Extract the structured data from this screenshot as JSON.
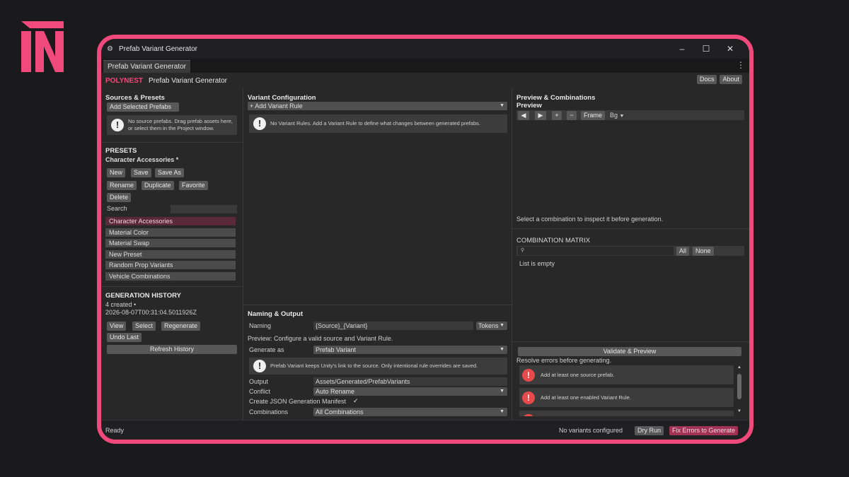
{
  "colors": {
    "accent": "#ef4a7b",
    "error": "#e64a4a",
    "panel": "#282828"
  },
  "logo": {
    "text": "TN"
  },
  "window": {
    "title": "Prefab Variant Generator",
    "controls": [
      "–",
      "☐",
      "✕"
    ]
  },
  "tab": {
    "label": "Prefab Variant Generator",
    "menu_icon": "⋮"
  },
  "header": {
    "brand": "POLYNEST",
    "title": "Prefab Variant Generator",
    "docs": "Docs",
    "about": "About"
  },
  "sources": {
    "title": "Sources & Presets",
    "add_button": "Add Selected Prefabs",
    "help": "No source prefabs. Drag prefab assets here, or select them in the Project window."
  },
  "presets": {
    "title": "PRESETS",
    "current": "Character Accessories *",
    "buttons": {
      "new": "New",
      "save": "Save",
      "save_as": "Save As",
      "rename": "Rename",
      "duplicate": "Duplicate",
      "favorite": "Favorite",
      "delete": "Delete"
    },
    "search_label": "Search",
    "items": [
      "Character Accessories",
      "Material Color",
      "Material Swap",
      "New Preset",
      "Random Prop Variants",
      "Vehicle Combinations"
    ]
  },
  "history": {
    "title": "GENERATION HISTORY",
    "line1": "4 created •",
    "line2": "2026-08-07T00:31:04.5011926Z",
    "buttons": {
      "view": "View",
      "select": "Select",
      "regenerate": "Regenerate",
      "undo": "Undo Last",
      "refresh": "Refresh History"
    }
  },
  "variant": {
    "title": "Variant Configuration",
    "add_rule": "+ Add Variant Rule",
    "help": "No Variant Rules. Add a Variant Rule to define what changes between generated prefabs."
  },
  "naming": {
    "title": "Naming & Output",
    "naming_label": "Naming",
    "naming_value": "{Source}_{Variant}",
    "tokens": "Tokens",
    "preview": "Preview: Configure a valid source and Variant Rule.",
    "generate_as_label": "Generate as",
    "generate_as_value": "Prefab Variant",
    "generate_help": "Prefab Variant keeps Unity's link to the source. Only intentional rule overrides are saved.",
    "output_label": "Output",
    "output_value": "Assets/Generated/PrefabVariants",
    "conflict_label": "Conflict",
    "conflict_value": "Auto Rename",
    "manifest_label": "Create JSON Generation Manifest",
    "manifest_check": "✓",
    "combinations_label": "Combinations",
    "combinations_value": "All Combinations"
  },
  "preview": {
    "title": "Preview & Combinations",
    "subtitle": "Preview",
    "toolbar": {
      "prev": "◀",
      "next": "▶",
      "plus": "+",
      "minus": "−",
      "frame": "Frame",
      "bg": "Bg"
    },
    "empty": "Select a combination to inspect it before generation."
  },
  "matrix": {
    "title": "COMBINATION MATRIX",
    "all": "All",
    "none": "None",
    "empty": "List is empty"
  },
  "validate": {
    "button": "Validate & Preview",
    "message": "Resolve errors before generating.",
    "errors": [
      "Add at least one source prefab.",
      "Add at least one enabled Variant Rule."
    ]
  },
  "status": {
    "left": "Ready",
    "info": "No variants configured",
    "dry_run": "Dry Run",
    "fix": "Fix Errors to Generate"
  }
}
